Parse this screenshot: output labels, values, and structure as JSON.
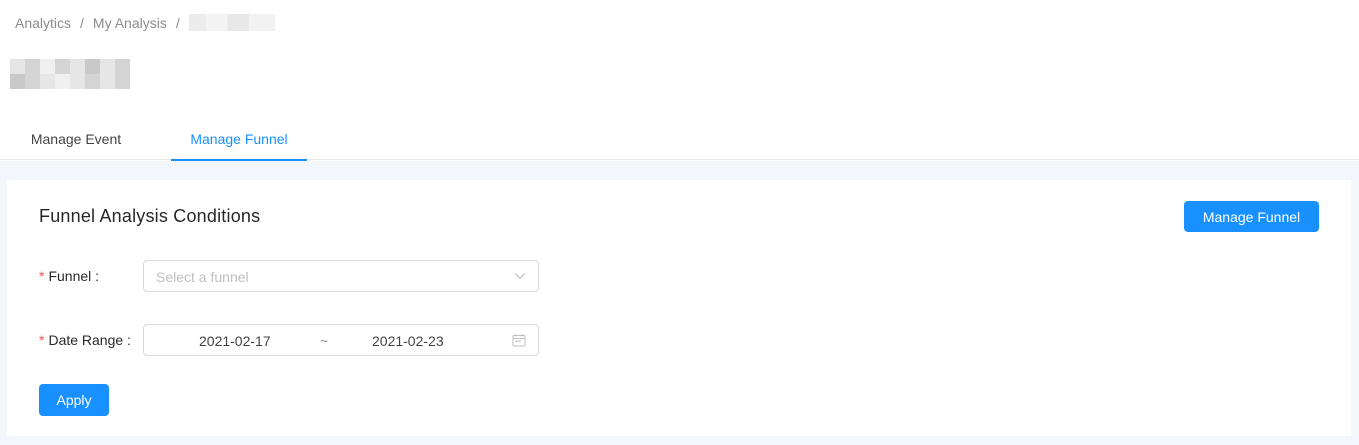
{
  "breadcrumb": {
    "items": [
      "Analytics",
      "My Analysis"
    ],
    "separator": "/"
  },
  "tabs": [
    {
      "label": "Manage Event",
      "active": false
    },
    {
      "label": "Manage Funnel",
      "active": true
    }
  ],
  "card": {
    "title": "Funnel Analysis Conditions",
    "manage_button_label": "Manage Funnel",
    "funnel": {
      "required_mark": "*",
      "label": "Funnel :",
      "placeholder": "Select a funnel",
      "icon": "chevron-down-icon"
    },
    "date_range": {
      "required_mark": "*",
      "label": "Date Range :",
      "start": "2021-02-17",
      "separator": "~",
      "end": "2021-02-23",
      "icon": "calendar-icon"
    },
    "apply_button_label": "Apply"
  },
  "colors": {
    "primary": "#1890ff",
    "required": "#ff4d4f",
    "page_background": "#f3f6fb"
  }
}
